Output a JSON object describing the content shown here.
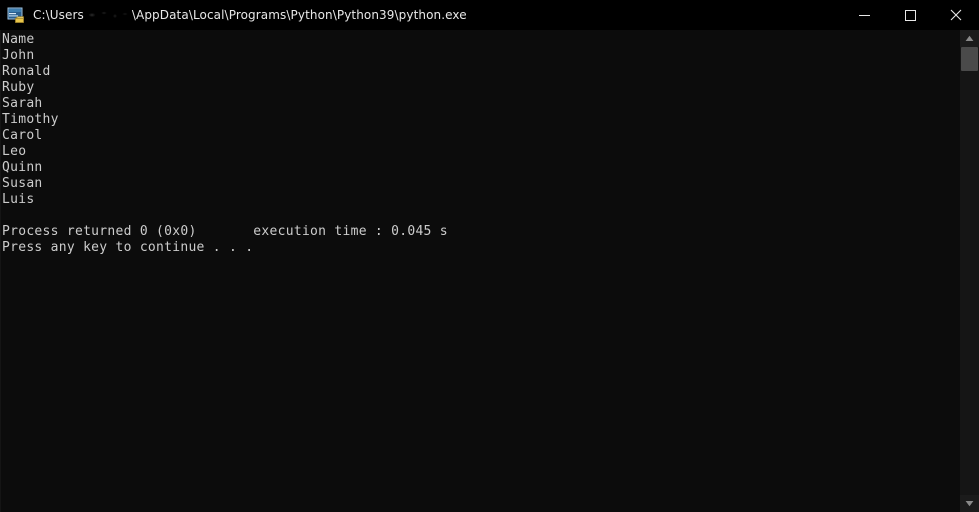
{
  "window": {
    "title_prefix": "C:\\Users",
    "title_redacted_user": "",
    "title_suffix": "\\AppData\\Local\\Programs\\Python\\Python39\\python.exe",
    "icon": "console-app-icon"
  },
  "titlebar": {
    "minimize_label": "Minimize",
    "maximize_label": "Maximize",
    "close_label": "Close"
  },
  "console": {
    "lines": [
      "Name",
      "John",
      "Ronald",
      "Ruby",
      "Sarah",
      "Timothy",
      "Carol",
      "Leo",
      "Quinn",
      "Susan",
      "Luis",
      "",
      "Process returned 0 (0x0)       execution time : 0.045 s",
      "Press any key to continue . . ."
    ],
    "text": "Name\nJohn\nRonald\nRuby\nSarah\nTimothy\nCarol\nLeo\nQuinn\nSusan\nLuis\n\nProcess returned 0 (0x0)       execution time : 0.045 s\nPress any key to continue . . .",
    "exit_code": "0 (0x0)",
    "execution_time": "0.045 s",
    "prompt": "Press any key to continue . . ."
  },
  "scrollbar": {
    "up_label": "Scroll up",
    "down_label": "Scroll down",
    "thumb_label": "Scroll thumb"
  },
  "colors": {
    "titlebar_bg": "#000000",
    "console_bg": "#0c0c0c",
    "console_fg": "#cccccc",
    "scrollbar_track": "#151515",
    "scrollbar_thumb": "#4a4a4a",
    "close_hover": "#c42b1c"
  }
}
